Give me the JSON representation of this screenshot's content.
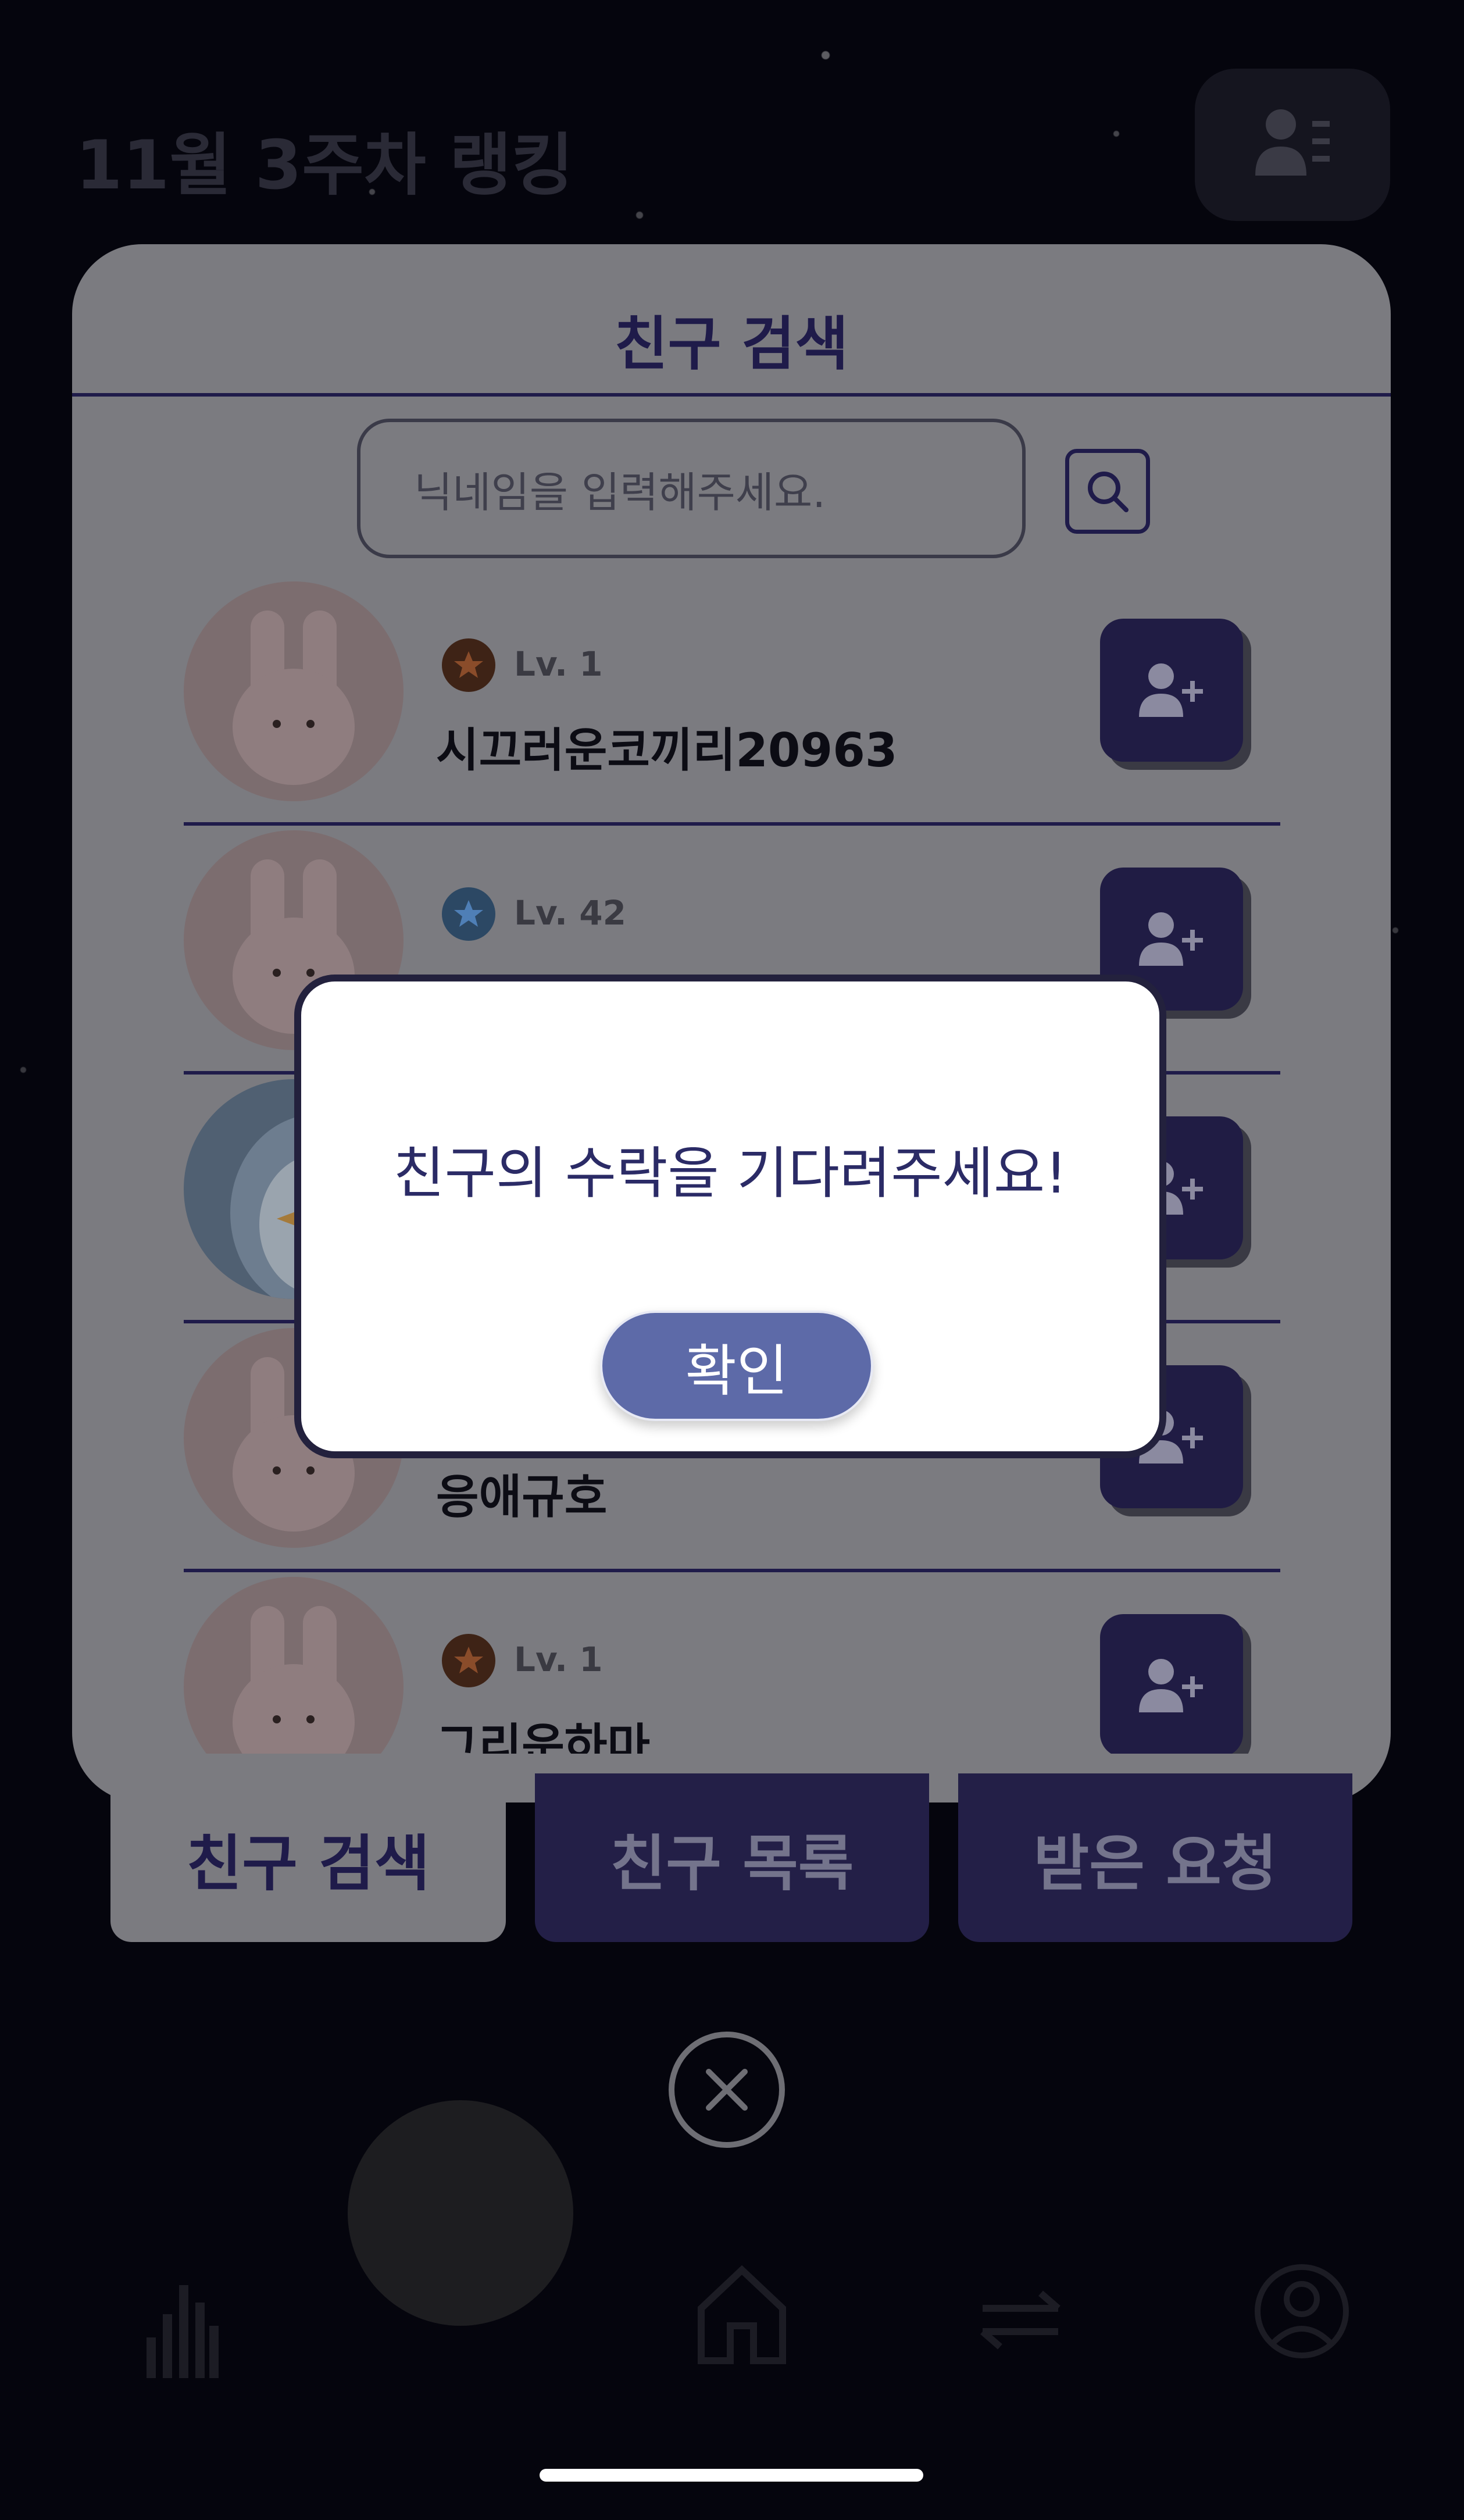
{
  "background": {
    "ranking_title": "11월 3주차 랭킹",
    "tabs": [
      {
        "label": "친구 검색",
        "active": true
      },
      {
        "label": "친구 목록",
        "active": false
      },
      {
        "label": "받은 요청",
        "active": false
      }
    ],
    "bottom_nav": [
      "ranking-icon",
      "home-icon",
      "exchange-icon",
      "profile-icon"
    ]
  },
  "panel": {
    "title": "친구 검색",
    "search": {
      "placeholder": "닉네임을 입력해주세요.",
      "value": ""
    },
    "results": [
      {
        "avatar": "rabbit",
        "badge": "bronze",
        "level": "Lv. 1",
        "nickname": "시끄러운코끼리20963"
      },
      {
        "avatar": "rabbit",
        "badge": "blue",
        "level": "Lv. 42",
        "nickname": ""
      },
      {
        "avatar": "penguin",
        "badge": "",
        "level": "",
        "nickname": ""
      },
      {
        "avatar": "rabbit",
        "badge": "",
        "level": "",
        "nickname": "응애규호"
      },
      {
        "avatar": "rabbit",
        "badge": "bronze",
        "level": "Lv. 1",
        "nickname": "그리운하마"
      }
    ]
  },
  "modal": {
    "message": "친구의 수락을 기다려주세요!",
    "confirm_label": "확인"
  },
  "colors": {
    "accent_navy": "#201c44",
    "confirm_button": "#5d6aa8",
    "modal_text": "#2b2b66"
  }
}
